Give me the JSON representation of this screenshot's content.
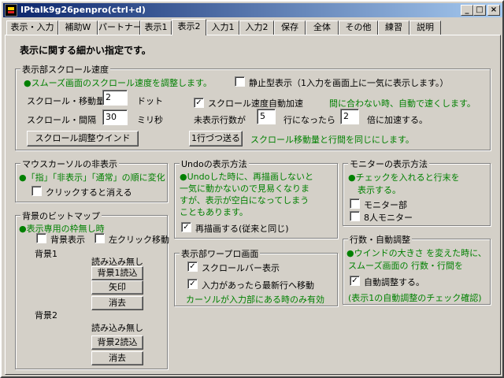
{
  "window": {
    "title": "IPtalk9g26penpro(ctrl+d)"
  },
  "tabs": [
    {
      "label": "表示・入力"
    },
    {
      "label": "補助W"
    },
    {
      "label": "パートナー"
    },
    {
      "label": "表示1"
    },
    {
      "label": "表示2",
      "active": true
    },
    {
      "label": "入力1"
    },
    {
      "label": "入力2"
    },
    {
      "label": "保存"
    },
    {
      "label": "全体"
    },
    {
      "label": "その他"
    },
    {
      "label": "練習"
    },
    {
      "label": "説明"
    }
  ],
  "page_heading": "表示に関する細かい指定です。",
  "scroll": {
    "title": "表示部スクロール速度",
    "desc": "●スムーズ画面のスクロール速度を調整します。",
    "static_label": "静止型表示（1入力を画面上に一気に表示します。）",
    "static_checked": false,
    "move_label": "スクロール・移動量",
    "move_value": "2",
    "move_unit": "ドット",
    "interval_label": "スクロール・間隔",
    "interval_value": "30",
    "interval_unit": "ミリ秒",
    "auto_accel_label": "スクロール速度自動加速",
    "auto_accel_checked": true,
    "auto_accel_note": "間に合わない時、自動で速くします。",
    "lines_label": "未表示行数が",
    "lines_value": "5",
    "lines_suffix": "行になったら",
    "times_value": "2",
    "times_suffix": "倍に加速する。",
    "adjust_button": "スクロール調整ウインド",
    "one_line_button": "1行づつ送る",
    "same_note": "スクロール移動量と行間を同じにします。"
  },
  "mouse": {
    "title": "マウスカーソルの非表示",
    "desc": "●「指」「非表示」「通常」の順に変化",
    "click_label": "クリックすると消える",
    "click_checked": false
  },
  "bg": {
    "title": "背景のビットマップ",
    "desc": "●表示専用の枠無し時",
    "show_label": "背景表示",
    "show_checked": false,
    "left_click_label": "左クリック移動",
    "left_click_checked": false,
    "bg1_label": "背景1",
    "bg1_status": "読み込み無し",
    "bg1_load": "背景1読込",
    "arrow_button": "矢印",
    "bg1_clear": "消去",
    "bg2_label": "背景2",
    "bg2_status": "読み込み無し",
    "bg2_load": "背景2読込",
    "bg2_clear": "消去"
  },
  "undo": {
    "title": "Undoの表示方法",
    "desc1": "●Undoした時に、再描画しないと",
    "desc2": "一気に動かないので見易くなりま",
    "desc3": "すが、表示が空白になってしまう",
    "desc4": "こともあります。",
    "redraw_label": "再描画する(従来と同じ)",
    "redraw_checked": true
  },
  "warp": {
    "title": "表示部ワープロ画面",
    "scrollbar_label": "スクロールバー表示",
    "scrollbar_checked": true,
    "move_last_label": "入力があったら最新行へ移動",
    "move_last_checked": true,
    "note": "カーソルが入力部にある時のみ有効"
  },
  "monitor": {
    "title": "モニターの表示方法",
    "desc1": "●チェックを入れると行末を",
    "desc2": "表示する。",
    "monitor_label": "モニター部",
    "monitor_checked": false,
    "eight_label": "8人モニター",
    "eight_checked": false
  },
  "autoadjust": {
    "title": "行数・自動調整",
    "desc1": "●ウインドの大きさ を変えた時に、",
    "desc2": "スムーズ画面の 行数・行間を",
    "check_label": "自動調整する。",
    "checked": true,
    "note": "(表示1の自動調整のチェック確認)"
  },
  "colors": {
    "title_start": "#0a246a",
    "title_end": "#a6caf0",
    "note_green": "#008000"
  }
}
